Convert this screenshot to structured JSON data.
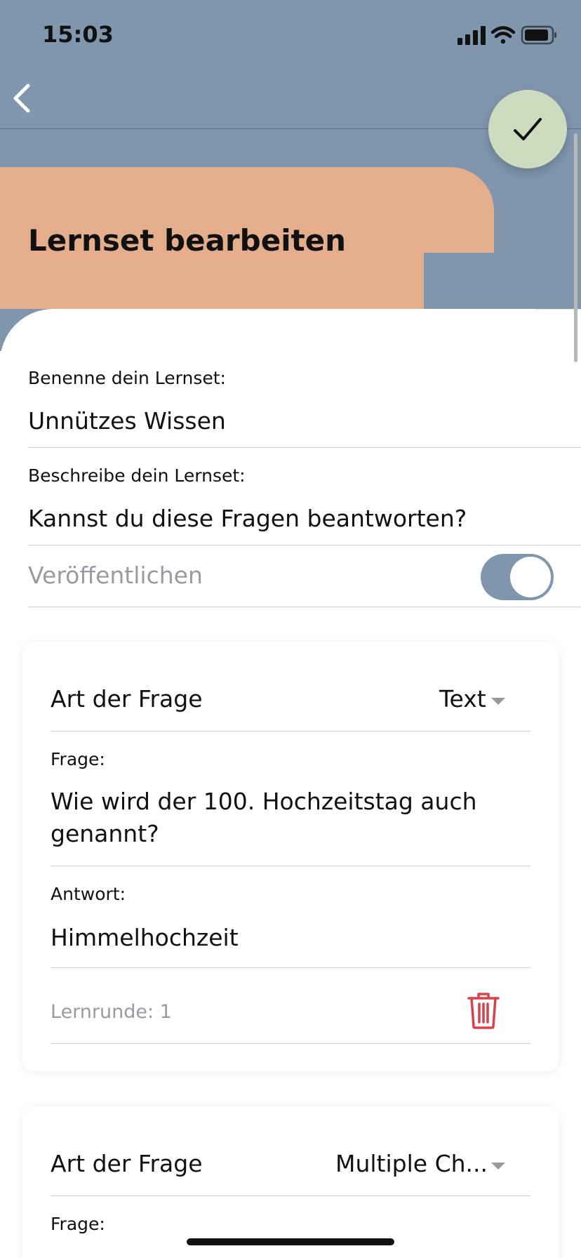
{
  "status_bar": {
    "time": "15:03"
  },
  "header": {
    "title": "Lernset bearbeiten"
  },
  "form": {
    "name_label": "Benenne dein Lernset:",
    "name_value": "Unnützes Wissen",
    "description_label": "Beschreibe dein Lernset:",
    "description_value": "Kannst du diese Fragen beantworten?",
    "publish_label": "Veröffentlichen",
    "publish_on": true
  },
  "cards": [
    {
      "type_label": "Art der Frage",
      "type_value": "Text",
      "question_label": "Frage:",
      "question_value_line1": "Wie wird der 100. Hochzeitstag auch",
      "question_value_line2": "genannt?",
      "answer_label": "Antwort:",
      "answer_value": "Himmelhochzeit",
      "round_text": "Lernrunde: 1"
    },
    {
      "type_label": "Art der Frage",
      "type_value": "Multiple Ch...",
      "question_label": "Frage:"
    }
  ],
  "colors": {
    "header_blue": "#7f96ad",
    "header_card": "#e4ae8d",
    "check_button": "#cddbbf",
    "delete_red": "#d9424a"
  },
  "icons": [
    "back-chevron-icon",
    "checkmark-icon",
    "signal-icon",
    "wifi-icon",
    "battery-icon",
    "dropdown-caret-icon",
    "trash-icon"
  ]
}
